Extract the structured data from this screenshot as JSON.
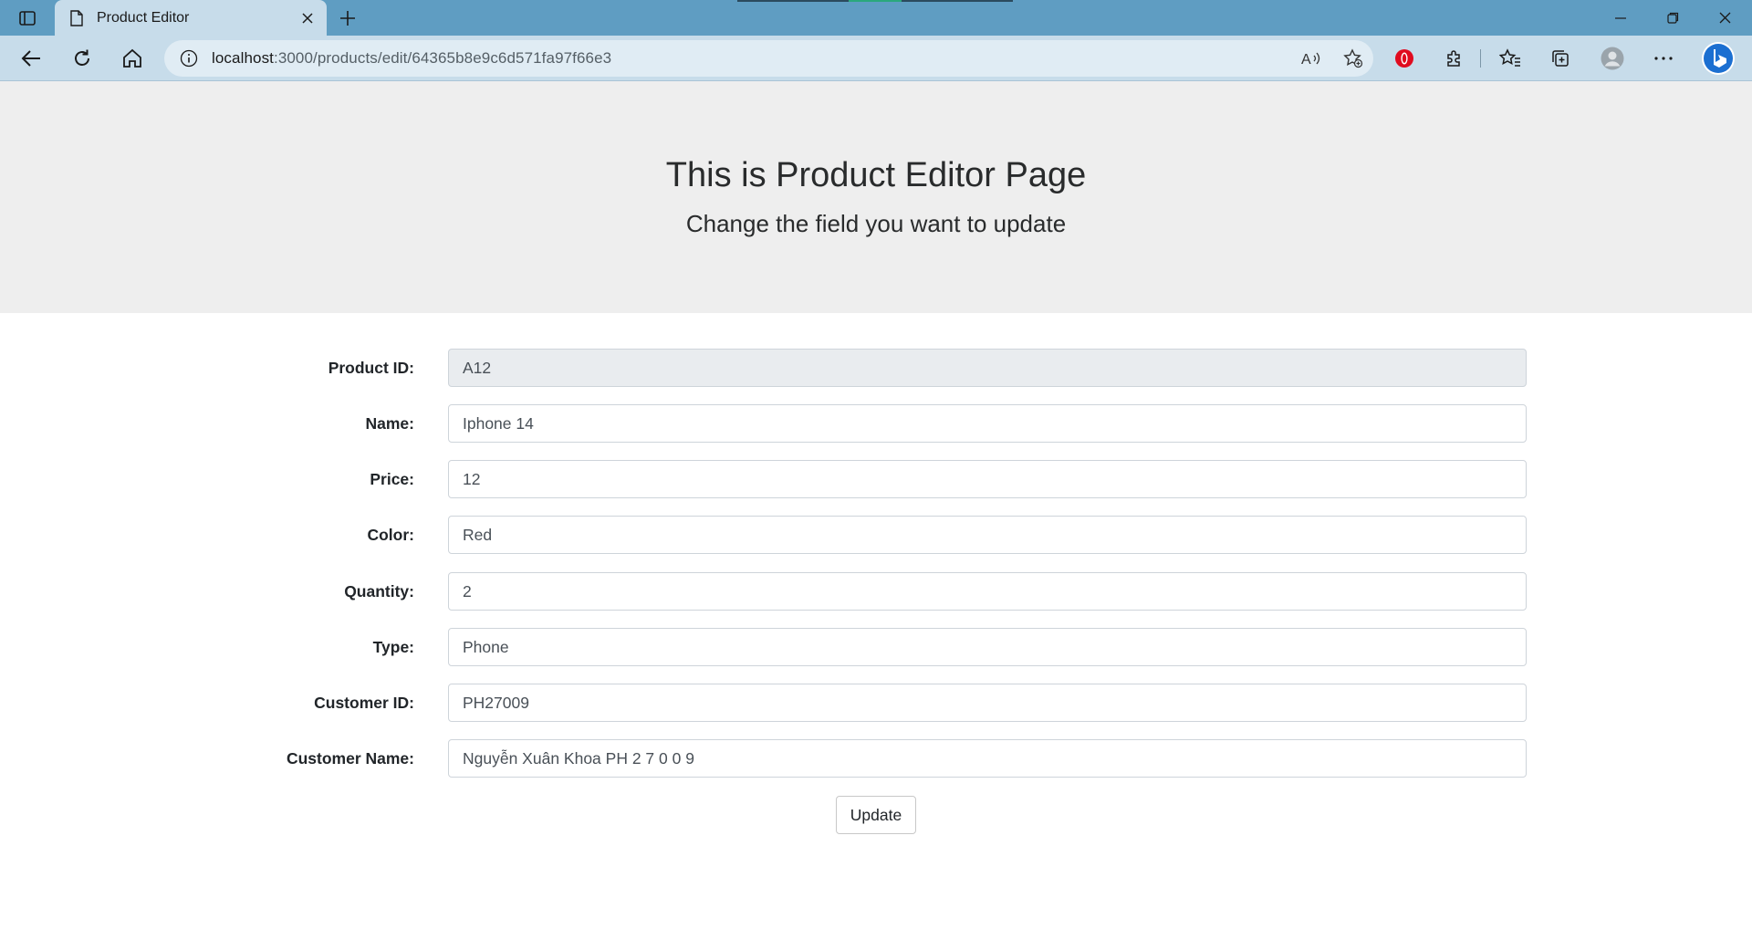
{
  "browser": {
    "tab": {
      "title": "Product Editor"
    },
    "address": {
      "host": "localhost",
      "path": ":3000/products/edit/64365b8e9c6d571fa97f66e3"
    }
  },
  "page": {
    "heading": "This is Product Editor Page",
    "subheading": "Change the field you want to update",
    "fields": [
      {
        "label": "Product ID:",
        "value": "A12"
      },
      {
        "label": "Name:",
        "value": "Iphone 14"
      },
      {
        "label": "Price:",
        "value": "12"
      },
      {
        "label": "Color:",
        "value": "Red"
      },
      {
        "label": "Quantity:",
        "value": "2"
      },
      {
        "label": "Type:",
        "value": "Phone"
      },
      {
        "label": "Customer ID:",
        "value": "PH27009"
      },
      {
        "label": "Customer Name:",
        "value": "Nguyễn Xuân Khoa PH 2 7 0 0 9"
      }
    ],
    "update_label": "Update"
  },
  "colors": {
    "titlebar": "#5f9dc2",
    "toolbar": "#c7dcea",
    "hero_bg": "#eeeeee"
  }
}
